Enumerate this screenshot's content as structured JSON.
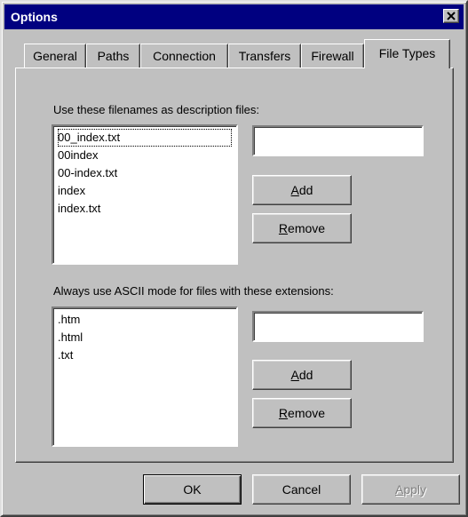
{
  "window": {
    "title": "Options"
  },
  "tabs": [
    "General",
    "Paths",
    "Connection",
    "Transfers",
    "Firewall",
    "File Types"
  ],
  "active_tab": "File Types",
  "description_files": {
    "label": "Use these filenames as description files:",
    "items": [
      "00_index.txt",
      "00index",
      "00-index.txt",
      "index",
      "index.txt"
    ],
    "input_value": "",
    "add_label_first": "A",
    "add_label_rest": "dd",
    "remove_label_first": "R",
    "remove_label_rest": "emove"
  },
  "ascii_extensions": {
    "label": "Always use ASCII mode for files with these extensions:",
    "items": [
      ".htm",
      ".html",
      ".txt"
    ],
    "input_value": "",
    "add_label_first": "A",
    "add_label_rest": "dd",
    "remove_label_first": "R",
    "remove_label_rest": "emove"
  },
  "footer": {
    "ok": "OK",
    "cancel": "Cancel",
    "apply_first": "A",
    "apply_rest": "pply"
  }
}
